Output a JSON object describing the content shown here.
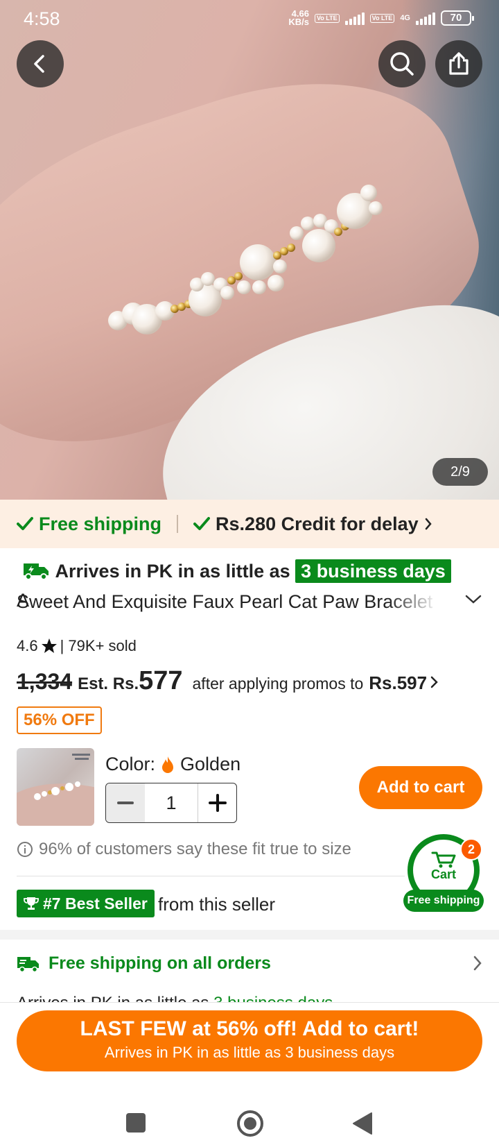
{
  "status_bar": {
    "time": "4:58",
    "speed_value": "4.66",
    "speed_unit": "KB/s",
    "volte_1": "Vo LTE",
    "volte_2": "Vo LTE",
    "network": "4G",
    "battery": "70"
  },
  "hero": {
    "image_counter": "2/9"
  },
  "shipping_strip": {
    "free_shipping": "Free shipping",
    "credit": "Rs.280 Credit for delay"
  },
  "product": {
    "arrives_prefix": "Arrives in PK in as little as",
    "arrives_days": "3 business days",
    "title_start": "A",
    "title_line2": "Sweet And Exquisite Faux Pearl Cat Paw Bracelet",
    "rating": "4.6",
    "sold": "| 79K+ sold",
    "original_price": "1,334",
    "est_label": "Est. Rs.",
    "est_price": "577",
    "promo_text": "after applying promos to",
    "promo_price": "Rs.597",
    "discount_badge": "56% OFF",
    "color_label": "Color:",
    "color_value": "Golden",
    "quantity": "1",
    "add_to_cart": "Add to cart",
    "fit_note": "96% of customers say these fit true to size",
    "best_seller": "#7 Best Seller",
    "best_seller_suffix": "from this seller"
  },
  "floating_cart": {
    "label": "Cart",
    "count": "2",
    "free_shipping": "Free shipping"
  },
  "shipping_section": {
    "title": "Free shipping on all orders",
    "arrives_prefix": "Arrives in PK in as little as",
    "arrives_days": "3 business days"
  },
  "cta": {
    "line1": "LAST FEW at 56% off! Add to cart!",
    "line2": "Arrives in PK in as little as 3 business days"
  },
  "colors": {
    "brand_orange": "#fb7701",
    "brand_green": "#0a8a1c"
  }
}
